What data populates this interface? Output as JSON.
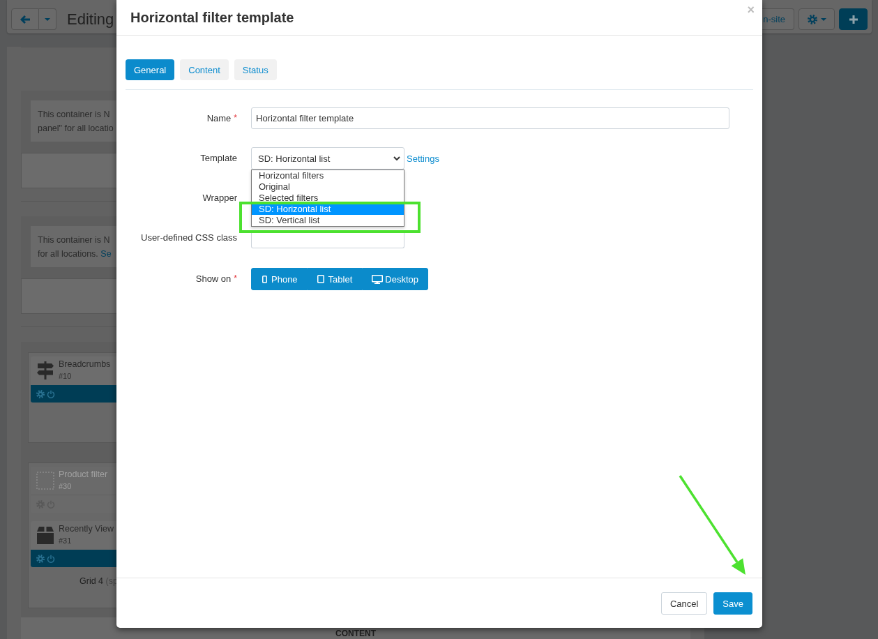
{
  "toolbar": {
    "title": "Editing",
    "view_button": "n-site"
  },
  "sections": [
    {
      "notice": [
        "This container is N",
        "panel\" for all locatio"
      ]
    },
    {
      "notice": [
        "This container is N",
        "for all locations."
      ],
      "link": "Se"
    }
  ],
  "grids": [
    {
      "blocks": [
        {
          "kind": "breadcrumbs",
          "title": "Breadcrumbs",
          "id": "#10",
          "active": true
        }
      ]
    },
    {
      "blocks": [
        {
          "kind": "filters",
          "title": "Product filter",
          "id": "#30",
          "active": false
        },
        {
          "kind": "products",
          "title": "Recently View",
          "id": "#31",
          "active": true
        }
      ],
      "caption": "Grid 4",
      "caption_note": "(sp"
    }
  ],
  "content_label": "CONTENT",
  "modal": {
    "title": "Horizontal filter template",
    "close": "×",
    "tabs": [
      {
        "label": "General",
        "selected": true
      },
      {
        "label": "Content",
        "selected": false
      },
      {
        "label": "Status",
        "selected": false
      }
    ],
    "fields": [
      {
        "kind": "text",
        "label": "Name",
        "mark": "*",
        "value": "Horizontal filter template"
      },
      {
        "kind": "select",
        "label": "Template",
        "value": "SD: Horizontal list",
        "link": "Settings",
        "expanded": true,
        "highlighted": true,
        "options": [
          {
            "label": "Horizontal filters",
            "selected": false
          },
          {
            "label": "Original",
            "selected": false
          },
          {
            "label": "Selected filters",
            "selected": false
          },
          {
            "label": "SD: Horizontal list",
            "selected": true
          },
          {
            "label": "SD: Vertical list",
            "selected": false
          }
        ]
      },
      {
        "kind": "covered",
        "label": "Wrapper"
      },
      {
        "kind": "short",
        "label": "User-defined CSS class"
      },
      {
        "kind": "devices",
        "label": "Show on",
        "mark": "*",
        "options": [
          {
            "kind": "phone",
            "label": "Phone",
            "selected": true
          },
          {
            "kind": "tablet",
            "label": "Tablet",
            "selected": true
          },
          {
            "kind": "desktop",
            "label": "Desktop",
            "selected": true
          }
        ]
      }
    ],
    "buttons": [
      {
        "kind": "secondary",
        "label": "Cancel"
      },
      {
        "kind": "primary",
        "label": "Save",
        "pointed_at": true
      }
    ]
  }
}
